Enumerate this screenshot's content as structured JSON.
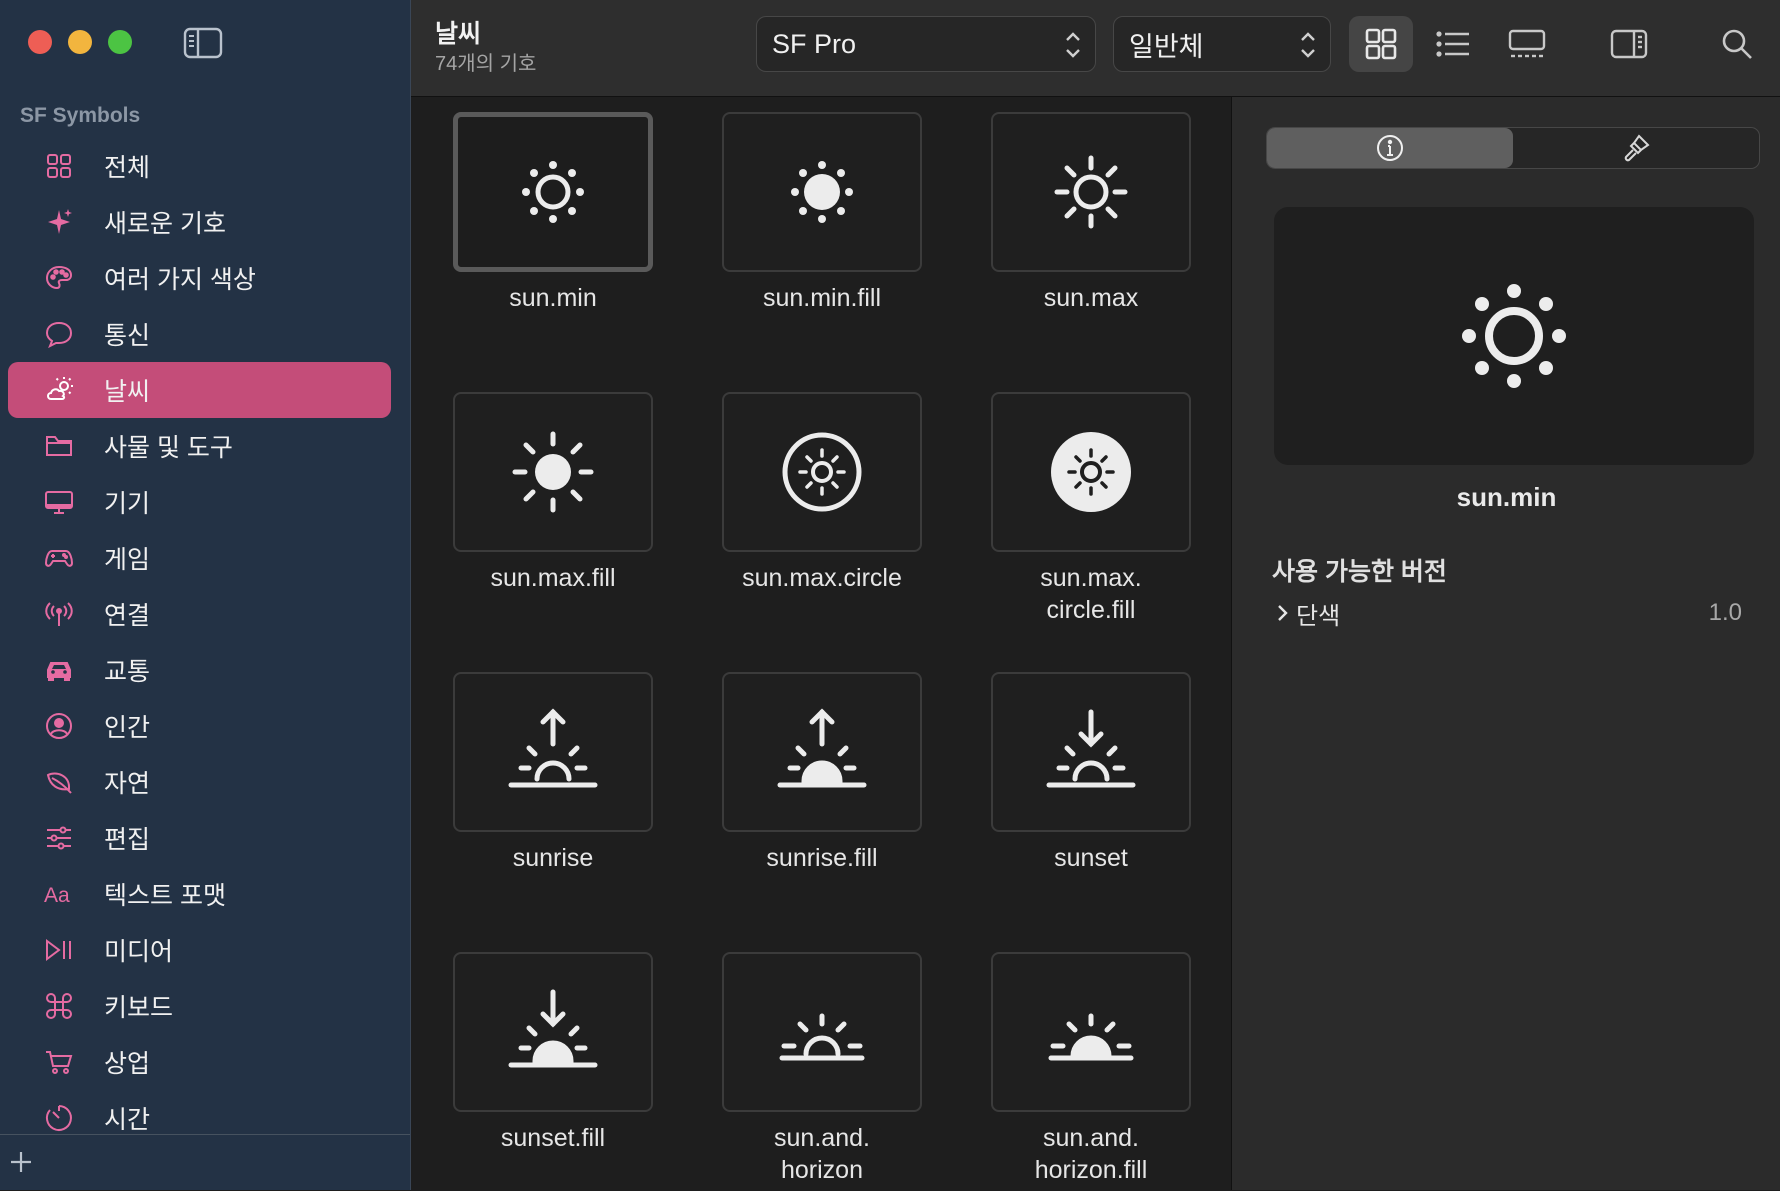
{
  "colors": {
    "accent": "#c44d79",
    "sidebar_icon": "#e56ba2",
    "sidebar_bg": "#233245"
  },
  "sidebar": {
    "section_title": "SF Symbols",
    "items": [
      {
        "label": "전체",
        "icon": "grid-icon"
      },
      {
        "label": "새로운 기호",
        "icon": "sparkles-icon"
      },
      {
        "label": "여러 가지 색상",
        "icon": "palette-icon"
      },
      {
        "label": "통신",
        "icon": "message-bubble-icon"
      },
      {
        "label": "날씨",
        "icon": "cloud-sun-icon",
        "active": true
      },
      {
        "label": "사물 및 도구",
        "icon": "folder-icon"
      },
      {
        "label": "기기",
        "icon": "desktop-icon"
      },
      {
        "label": "게임",
        "icon": "gamecontroller-icon"
      },
      {
        "label": "연결",
        "icon": "antenna-icon"
      },
      {
        "label": "교통",
        "icon": "car-icon"
      },
      {
        "label": "인간",
        "icon": "person-circle-icon"
      },
      {
        "label": "자연",
        "icon": "leaf-icon"
      },
      {
        "label": "편집",
        "icon": "sliders-icon"
      },
      {
        "label": "텍스트 포맷",
        "icon": "textformat-icon"
      },
      {
        "label": "미디어",
        "icon": "play-pause-icon"
      },
      {
        "label": "키보드",
        "icon": "command-icon"
      },
      {
        "label": "상업",
        "icon": "cart-icon"
      },
      {
        "label": "시간",
        "icon": "timer-icon"
      }
    ]
  },
  "toolbar": {
    "title": "날씨",
    "subtitle": "74개의 기호",
    "font_select": "SF Pro",
    "weight_select": "일반체"
  },
  "grid": {
    "symbols": [
      {
        "name": "sun.min",
        "icon": "sun-min-icon",
        "selected": true
      },
      {
        "name": "sun.min.fill",
        "icon": "sun-min-fill-icon"
      },
      {
        "name": "sun.max",
        "icon": "sun-max-icon"
      },
      {
        "name": "sun.max.fill",
        "icon": "sun-max-fill-icon"
      },
      {
        "name": "sun.max.circle",
        "icon": "sun-max-circle-icon"
      },
      {
        "name": "sun.max.\ncircle.fill",
        "icon": "sun-max-circle-fill-icon"
      },
      {
        "name": "sunrise",
        "icon": "sunrise-icon"
      },
      {
        "name": "sunrise.fill",
        "icon": "sunrise-fill-icon"
      },
      {
        "name": "sunset",
        "icon": "sunset-icon"
      },
      {
        "name": "sunset.fill",
        "icon": "sunset-fill-icon"
      },
      {
        "name": "sun.and.\nhorizon",
        "icon": "sun-and-horizon-icon"
      },
      {
        "name": "sun.and.\nhorizon.fill",
        "icon": "sun-and-horizon-fill-icon"
      }
    ]
  },
  "inspector": {
    "tabs": [
      {
        "icon": "info-icon",
        "active": true
      },
      {
        "icon": "paintbrush-icon"
      }
    ],
    "preview_name": "sun.min",
    "versions_title": "사용 가능한 버전",
    "version_row": {
      "label": "단색",
      "value": "1.0"
    }
  }
}
